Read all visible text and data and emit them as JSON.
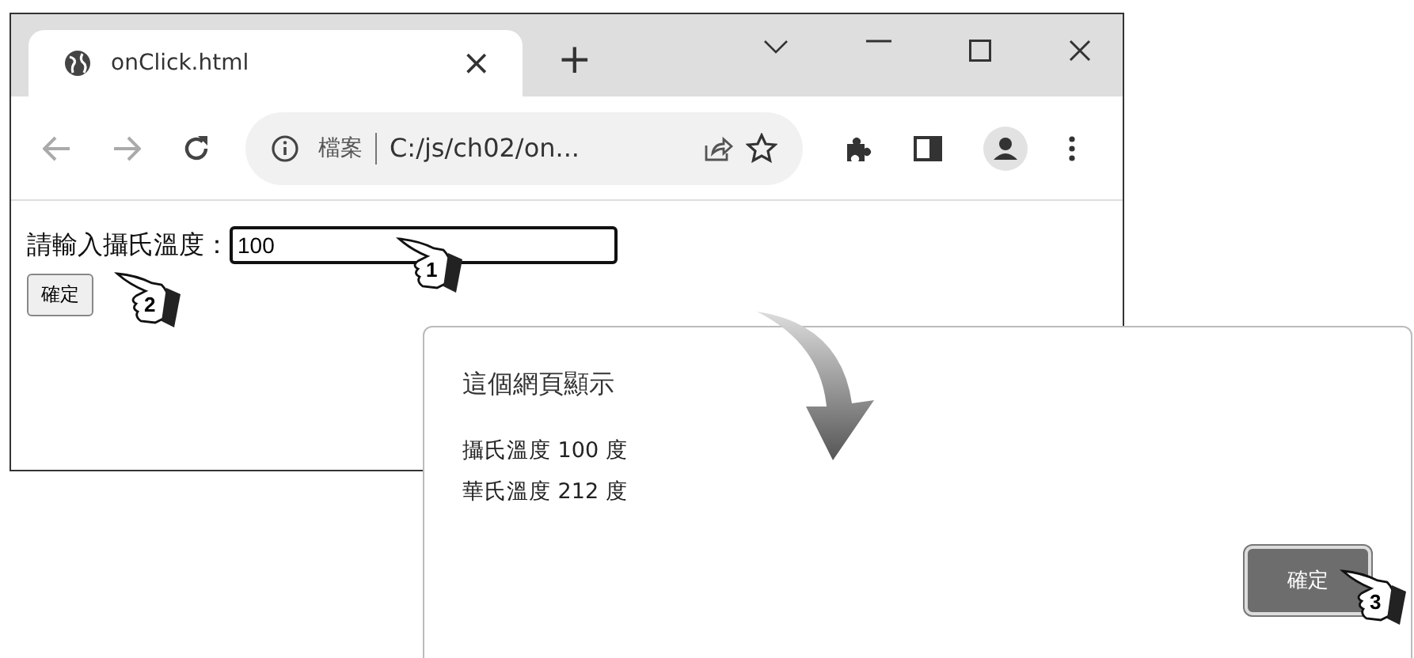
{
  "browser": {
    "tab": {
      "title": "onClick.html",
      "close": "×"
    },
    "new_tab": "+",
    "address": {
      "scheme": "檔案",
      "url": "C:/js/ch02/on..."
    }
  },
  "page": {
    "label": "請輸入攝氏溫度：",
    "input_value": "100",
    "button": "確定"
  },
  "dialog": {
    "title": "這個網頁顯示",
    "lines": [
      "攝氏溫度 100 度",
      "華氏溫度 212 度"
    ],
    "button": "確定"
  },
  "callouts": [
    {
      "number": "1"
    },
    {
      "number": "2"
    },
    {
      "number": "3"
    }
  ]
}
